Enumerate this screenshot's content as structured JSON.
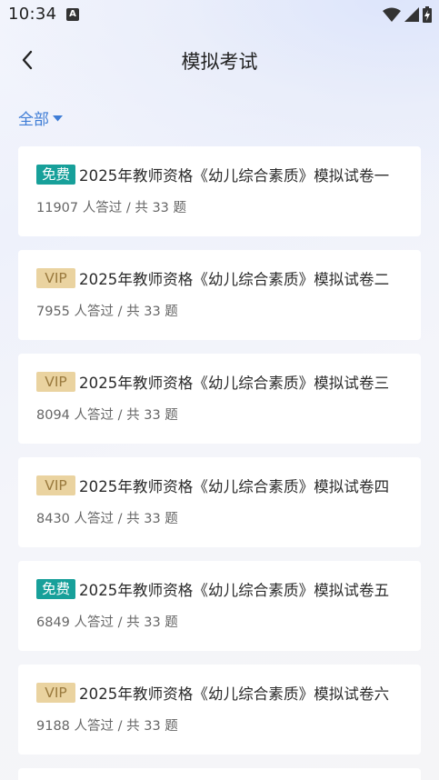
{
  "status_bar": {
    "time": "10:34",
    "a_icon": "A"
  },
  "header": {
    "title": "模拟考试",
    "back_icon": "chevron-left-icon"
  },
  "filter": {
    "label": "全部",
    "icon": "caret-down-icon"
  },
  "exams": [
    {
      "badge": "免费",
      "badge_type": "free",
      "title": "2025年教师资格《幼儿综合素质》模拟试卷一",
      "meta": "11907 人答过 / 共 33 题"
    },
    {
      "badge": "VIP",
      "badge_type": "vip",
      "title": "2025年教师资格《幼儿综合素质》模拟试卷二",
      "meta": "7955 人答过 / 共 33 题"
    },
    {
      "badge": "VIP",
      "badge_type": "vip",
      "title": "2025年教师资格《幼儿综合素质》模拟试卷三",
      "meta": "8094 人答过 / 共 33 题"
    },
    {
      "badge": "VIP",
      "badge_type": "vip",
      "title": "2025年教师资格《幼儿综合素质》模拟试卷四",
      "meta": "8430 人答过 / 共 33 题"
    },
    {
      "badge": "免费",
      "badge_type": "free",
      "title": "2025年教师资格《幼儿综合素质》模拟试卷五",
      "meta": "6849 人答过 / 共 33 题"
    },
    {
      "badge": "VIP",
      "badge_type": "vip",
      "title": "2025年教师资格《幼儿综合素质》模拟试卷六",
      "meta": "9188 人答过 / 共 33 题"
    }
  ],
  "colors": {
    "accent": "#3f7dd6",
    "free_badge": "#17a09a",
    "vip_badge": "#ead3a0",
    "vip_text": "#9a7a3e"
  }
}
